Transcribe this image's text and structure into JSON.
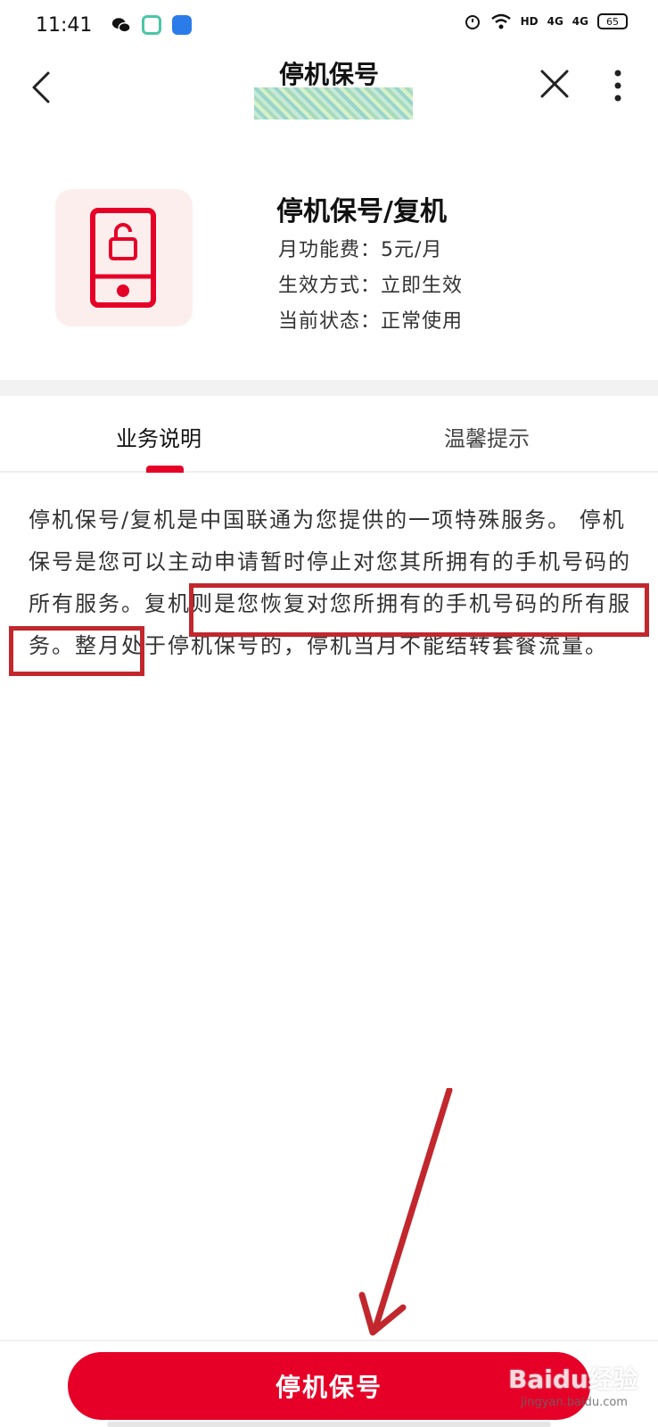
{
  "status": {
    "time": "11:41",
    "battery": "65",
    "network": "4G"
  },
  "nav": {
    "title": "停机保号"
  },
  "service": {
    "name": "停机保号/复机",
    "fee": "月功能费：5元/月",
    "effect": "生效方式：立即生效",
    "state": "当前状态：正常使用"
  },
  "tabs": {
    "business": "业务说明",
    "tips": "温馨提示"
  },
  "description": "停机保号/复机是中国联通为您提供的一项特殊服务。 停机保号是您可以主动申请暂时停止对您其所拥有的手机号码的所有服务。复机则是您恢复对您所拥有的手机号码的所有服务。整月处于停机保号的，停机当月不能结转套餐流量。",
  "button": {
    "label": "停机保号"
  },
  "watermark": {
    "brand": "Baidu经验",
    "url": "jingyan.baidu.com"
  },
  "colors": {
    "accent": "#e60027",
    "annotation": "#c1272d",
    "icon_bg": "#fdeeee"
  }
}
